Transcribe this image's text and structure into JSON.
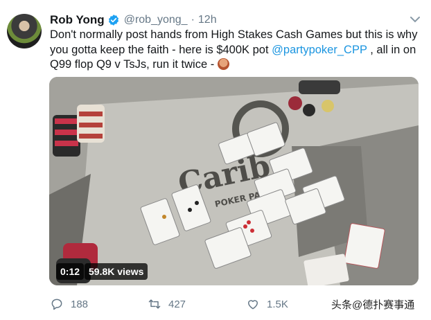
{
  "tweet": {
    "author_name": "Rob Yong",
    "handle": "@rob_yong_",
    "separator": "·",
    "time": "12h",
    "text_part1": "Don't normally post hands from High Stakes Cash Games but this is why you gotta keep the faith - here is $400K pot ",
    "mention": "@partypoker_CPP",
    "text_part2": " , all in on Q99 flop Q9 v TsJs, run it twice - ",
    "emoji": "see-no-evil-monkey"
  },
  "video": {
    "duration": "0:12",
    "views": "59.8K views",
    "table_logo_text": "Carib",
    "table_subtext": "POKER PAR"
  },
  "actions": {
    "reply_count": "188",
    "retweet_count": "427",
    "like_count": "1.5K"
  },
  "watermark": "头条@德扑赛事通",
  "colors": {
    "link": "#1b95e0",
    "verified": "#1da1f2",
    "muted": "#657786",
    "text": "#14171a"
  }
}
